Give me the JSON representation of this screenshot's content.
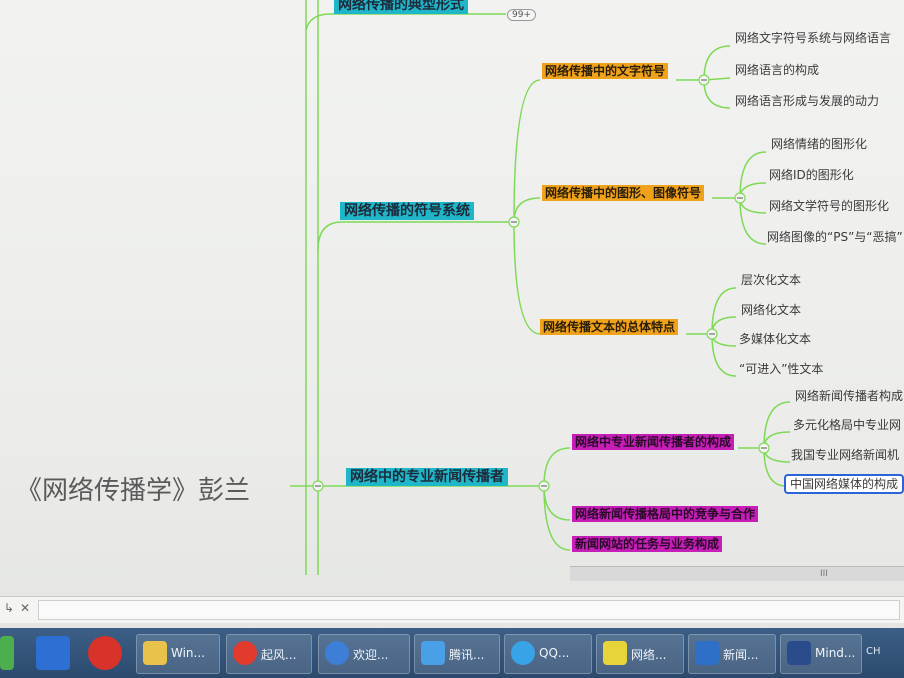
{
  "mindmap": {
    "root": "《网络传播学》彭兰",
    "branch_top": {
      "label": "网络传播的典型形式",
      "badge": "99+"
    },
    "branch_symbols": {
      "label": "网络传播的符号系统",
      "text_symbols": {
        "label": "网络传播中的文字符号",
        "items": [
          "网络文字符号系统与网络语言",
          "网络语言的构成",
          "网络语言形成与发展的动力"
        ]
      },
      "graphics": {
        "label": "网络传播中的图形、图像符号",
        "items": [
          "网络情绪的图形化",
          "网络ID的图形化",
          "网络文学符号的图形化",
          "网络图像的“PS”与“恶搞”"
        ]
      },
      "text_features": {
        "label": "网络传播文本的总体特点",
        "items": [
          "层次化文本",
          "网络化文本",
          "多媒体化文本",
          "“可进入”性文本"
        ]
      }
    },
    "branch_professional": {
      "label": "网络中的专业新闻传播者",
      "composition": {
        "label": "网络中专业新闻传播者的构成",
        "items": [
          "网络新闻传播者构成",
          "多元化格局中专业网",
          "我国专业网络新闻机",
          "中国网络媒体的构成"
        ]
      },
      "competition": {
        "label": "网络新闻传播格局中的竞争与合作"
      },
      "websites": {
        "label": "新闻网站的任务与业务构成"
      }
    }
  },
  "scrollbar": {
    "grip": "III"
  },
  "bottombar": {
    "left_icon": "↳",
    "close_icon": "✕"
  },
  "taskbar": {
    "items": [
      {
        "label": "Win...",
        "color": "#e8c24a"
      },
      {
        "label": "起风...",
        "color": "#e23a2c"
      },
      {
        "label": "欢迎...",
        "color": "#3d7fd6"
      },
      {
        "label": "腾讯...",
        "color": "#4aa0e6"
      },
      {
        "label": "QQ...",
        "color": "#38a3e6"
      },
      {
        "label": "网络...",
        "color": "#e7d33a"
      },
      {
        "label": "新闻...",
        "color": "#2e6fc7"
      },
      {
        "label": "Mind...",
        "color": "#2a4b8c"
      }
    ],
    "ime": "CH"
  },
  "colors": {
    "level1": "#1fb6c9",
    "level2_orange": "#f0a21a",
    "level2_magenta": "#c61fb8",
    "connector": "#7ed957",
    "selected_border": "#2b63d8"
  }
}
